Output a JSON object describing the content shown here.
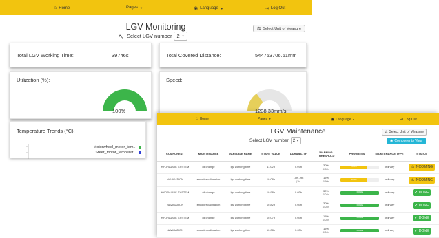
{
  "monitoring": {
    "nav": {
      "home": "Home",
      "pages": "Pages",
      "language": "Language",
      "logout": "Log Out"
    },
    "title": "LGV Monitoring",
    "select_label": "Select LGV number",
    "select_value": "2",
    "measure_button": "Select Unit of Measure",
    "working_time": {
      "label": "Total LGV Working Time:",
      "value": "39746s"
    },
    "distance": {
      "label": "Total Covered Distance:",
      "value": "544753706.61mm"
    },
    "utilization": {
      "label": "Utilization (%):",
      "value": "100%",
      "fraction": 1.0
    },
    "speed": {
      "label": "Speed:",
      "value": "1238.33mm/s",
      "fraction": 0.3
    },
    "temperature": {
      "label": "Temperature Trends (°C):",
      "legend": [
        {
          "name": "Motorwheel_motor_tem...",
          "color": "#3cb54a"
        },
        {
          "name": "Steer_motor_temperat...",
          "color": "#2f3fd6"
        }
      ]
    }
  },
  "maintenance": {
    "nav": {
      "home": "Home",
      "pages": "Pages",
      "language": "Language",
      "logout": "Log Out"
    },
    "title": "LGV Maintenance",
    "select_label": "Select LGV number",
    "select_value": "2",
    "measure_button": "Select Unit of Measure",
    "components_button": "Components View",
    "columns": [
      "COMPONENT",
      "MAINTENANCE",
      "VARIABLE NAME",
      "START VALUE",
      "DURABILITY",
      "WARNING THRESHOLD",
      "PROGRESS",
      "MAINTENANCE TYPE",
      "STATUS"
    ],
    "rows": [
      {
        "component": "HYDRAULIC SYSTEM",
        "maintenance": "oil change",
        "variable": "lgv working time",
        "start": "11.02h",
        "durability": "0.07h",
        "threshold": "30%",
        "threshold_sub": "(0.02h)",
        "progress": 0.7,
        "progress_label": "70.0%",
        "type": "ordinary",
        "status": "INCOMING",
        "status_kind": "incoming"
      },
      {
        "component": "NAVIGATION",
        "maintenance": "encoder calibration",
        "variable": "lgv working time",
        "start": "10.08h",
        "durability": "10h - 9h",
        "durability_sub": "(1h)",
        "threshold": "15%",
        "threshold_sub": "(0.60h)",
        "progress": 0.7,
        "progress_label": "70.0%",
        "type": "ordinary",
        "status": "INCOMING",
        "status_kind": "incoming"
      },
      {
        "component": "HYDRAULIC SYSTEM",
        "maintenance": "oil change",
        "variable": "lgv working time",
        "start": "10.98h",
        "durability": "0.03h",
        "threshold": "30%",
        "threshold_sub": "(0.04h)",
        "progress": 1.0,
        "progress_label": "DONE",
        "type": "ordinary",
        "status": "DONE",
        "status_kind": "done"
      },
      {
        "component": "NAVIGATION",
        "maintenance": "encoder calibration",
        "variable": "lgv working time",
        "start": "10.82h",
        "durability": "0.03h",
        "threshold": "30%",
        "threshold_sub": "(0.04h)",
        "progress": 1.0,
        "progress_label": "DONE",
        "type": "ordinary",
        "status": "DONE",
        "status_kind": "done"
      },
      {
        "component": "HYDRAULIC SYSTEM",
        "maintenance": "oil change",
        "variable": "lgv working time",
        "start": "10.07h",
        "durability": "0.03h",
        "threshold": "15%",
        "threshold_sub": "(0.04h)",
        "progress": 1.0,
        "progress_label": "DONE",
        "type": "ordinary",
        "status": "DONE",
        "status_kind": "done"
      },
      {
        "component": "NAVIGATION",
        "maintenance": "encoder calibration",
        "variable": "lgv working time",
        "start": "10.08h",
        "durability": "0.03h",
        "threshold": "15%",
        "threshold_sub": "(0.04h)",
        "progress": 1.0,
        "progress_label": "DONE",
        "type": "ordinary",
        "status": "DONE",
        "status_kind": "done"
      }
    ]
  },
  "colors": {
    "nav": "#f2c40f",
    "gauge_green": "#3cb54a",
    "gauge_yellow": "#e6cf5a",
    "gauge_track": "#e6e6e6",
    "info": "#24b6d6",
    "done": "#3cb54a",
    "warning": "#f2c40f"
  },
  "icons": {
    "home": "home-icon",
    "language": "globe-icon",
    "logout": "logout-icon",
    "measure": "scale-icon",
    "components": "eye-icon",
    "warning": "warning-icon",
    "check": "check-icon"
  }
}
